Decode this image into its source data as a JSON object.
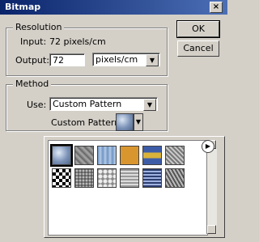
{
  "window": {
    "title": "Bitmap",
    "close_label": "×"
  },
  "buttons": {
    "ok_label": "OK",
    "cancel_label": "Cancel"
  },
  "resolution": {
    "group_label": "Resolution",
    "input_label": "Input:",
    "input_value": "72 pixels/cm",
    "output_label": "Output:",
    "output_value": "72",
    "units_value": "pixels/cm"
  },
  "method": {
    "group_label": "Method",
    "use_label": "Use:",
    "use_value": "Custom Pattern",
    "custom_pattern_label": "Custom Pattern"
  },
  "icons": {
    "dropdown": "▼",
    "flyout": "▶"
  },
  "colors": {
    "dialog_bg": "#d4d0c8",
    "titlebar_left": "#0a246a",
    "titlebar_right": "#4c6fb5"
  }
}
